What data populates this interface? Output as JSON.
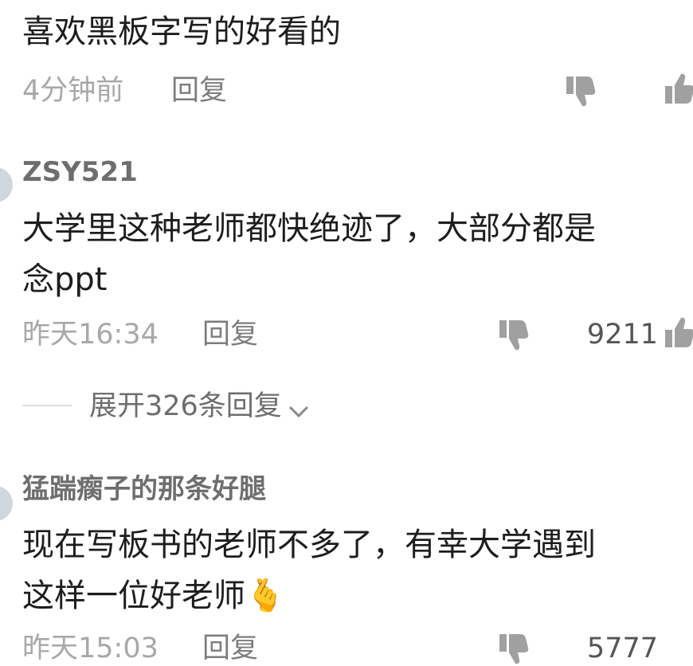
{
  "comments": [
    {
      "text_lines": [
        "喜欢黑板字写的好看的"
      ],
      "time": "4分钟前",
      "reply_label": "回复",
      "like_count": ""
    },
    {
      "username": "ZSY521",
      "text_lines": [
        "大学里这种老师都快绝迹了，大部分都是",
        "念ppt"
      ],
      "time": "昨天16:34",
      "reply_label": "回复",
      "like_count": "9211",
      "expand_label": "展开326条回复"
    },
    {
      "username": "猛踹瘸子的那条好腿",
      "text_lines": [
        "现在写板书的老师不多了，有幸大学遇到",
        "这样一位好老师🫰"
      ],
      "time": "昨天15:03",
      "reply_label": "回复",
      "like_count": "5777"
    }
  ],
  "icons": {
    "dislike": "thumbs-down-icon",
    "like": "thumbs-up-icon",
    "expand": "chevron-down-icon"
  },
  "colors": {
    "text": "#1d1d1d",
    "meta": "#a8a8a8",
    "username": "#6e6e6e",
    "icon": "#a0a0a0"
  }
}
